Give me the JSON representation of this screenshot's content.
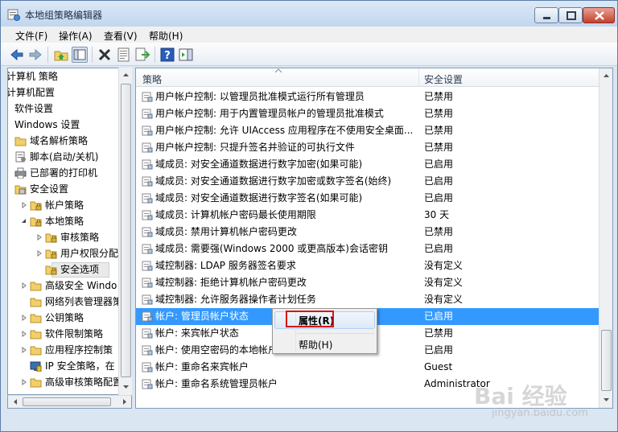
{
  "window": {
    "title": "本地组策略编辑器"
  },
  "menu": [
    {
      "label": "文件(F)"
    },
    {
      "label": "操作(A)"
    },
    {
      "label": "查看(V)"
    },
    {
      "label": "帮助(H)"
    }
  ],
  "toolbar": {
    "icons": [
      "back-icon",
      "forward-icon",
      "up-folder-icon",
      "show-hide-tree-icon",
      "delete-icon",
      "properties-icon",
      "export-list-icon",
      "help-icon",
      "show-action-pane-icon"
    ]
  },
  "tree": {
    "items": [
      {
        "label": "计算机 策略",
        "indent": 0,
        "icon": "none"
      },
      {
        "label": "计算机配置",
        "indent": 0,
        "icon": "none"
      },
      {
        "label": "软件设置",
        "indent": 1,
        "icon": "none"
      },
      {
        "label": "Windows 设置",
        "indent": 1,
        "icon": "none"
      },
      {
        "label": "域名解析策略",
        "indent": 2,
        "icon": "folder"
      },
      {
        "label": "脚本(启动/关机)",
        "indent": 2,
        "icon": "script"
      },
      {
        "label": "已部署的打印机",
        "indent": 2,
        "icon": "printer"
      },
      {
        "label": "安全设置",
        "indent": 2,
        "icon": "security"
      },
      {
        "label": "帐户策略",
        "indent": 3,
        "icon": "folder-lock",
        "twisty": "collapsed"
      },
      {
        "label": "本地策略",
        "indent": 3,
        "icon": "folder-lock",
        "twisty": "expanded"
      },
      {
        "label": "审核策略",
        "indent": 4,
        "icon": "folder-lock",
        "twisty": "collapsed"
      },
      {
        "label": "用户权限分配",
        "indent": 4,
        "icon": "folder-lock",
        "twisty": "collapsed"
      },
      {
        "label": "安全选项",
        "indent": 4,
        "icon": "folder-lock",
        "selected": true
      },
      {
        "label": "高级安全 Windo",
        "indent": 3,
        "icon": "folder",
        "twisty": "collapsed"
      },
      {
        "label": "网络列表管理器策",
        "indent": 3,
        "icon": "folder"
      },
      {
        "label": "公钥策略",
        "indent": 3,
        "icon": "folder",
        "twisty": "collapsed"
      },
      {
        "label": "软件限制策略",
        "indent": 3,
        "icon": "folder",
        "twisty": "collapsed"
      },
      {
        "label": "应用程序控制策",
        "indent": 3,
        "icon": "folder",
        "twisty": "collapsed"
      },
      {
        "label": "IP 安全策略，在",
        "indent": 3,
        "icon": "ipsec"
      },
      {
        "label": "高级审核策略配置",
        "indent": 3,
        "icon": "folder",
        "twisty": "collapsed"
      }
    ]
  },
  "list": {
    "columns": {
      "policy": "策略",
      "setting": "安全设置"
    },
    "rows": [
      {
        "policy": "用户帐户控制: 以管理员批准模式运行所有管理员",
        "setting": "已禁用"
      },
      {
        "policy": "用户帐户控制: 用于内置管理员帐户的管理员批准模式",
        "setting": "已禁用"
      },
      {
        "policy": "用户帐户控制: 允许 UIAccess 应用程序在不使用安全桌面...",
        "setting": "已禁用"
      },
      {
        "policy": "用户帐户控制: 只提升签名并验证的可执行文件",
        "setting": "已禁用"
      },
      {
        "policy": "域成员: 对安全通道数据进行数字加密(如果可能)",
        "setting": "已启用"
      },
      {
        "policy": "域成员: 对安全通道数据进行数字加密或数字签名(始终)",
        "setting": "已启用"
      },
      {
        "policy": "域成员: 对安全通道数据进行数字签名(如果可能)",
        "setting": "已启用"
      },
      {
        "policy": "域成员: 计算机帐户密码最长使用期限",
        "setting": "30 天"
      },
      {
        "policy": "域成员: 禁用计算机帐户密码更改",
        "setting": "已禁用"
      },
      {
        "policy": "域成员: 需要强(Windows 2000 或更高版本)会话密钥",
        "setting": "已启用"
      },
      {
        "policy": "域控制器: LDAP 服务器签名要求",
        "setting": "没有定义"
      },
      {
        "policy": "域控制器: 拒绝计算机帐户密码更改",
        "setting": "没有定义"
      },
      {
        "policy": "域控制器: 允许服务器操作者计划任务",
        "setting": "没有定义"
      },
      {
        "policy": "帐户: 管理员帐户状态",
        "setting": "已启用",
        "selected": true
      },
      {
        "policy": "帐户: 来宾帐户状态",
        "setting": "已禁用"
      },
      {
        "policy": "帐户: 使用空密码的本地帐户",
        "setting": "已启用"
      },
      {
        "policy": "帐户: 重命名来宾帐户",
        "setting": "Guest"
      },
      {
        "policy": "帐户: 重命名系统管理员帐户",
        "setting": "Administrator"
      }
    ]
  },
  "context_menu": {
    "items": [
      {
        "label": "属性(R)",
        "bold": true
      },
      {
        "label": "帮助(H)"
      }
    ]
  },
  "watermark": {
    "main": "Bai 经验",
    "sub": "jingyan.baidu.com"
  },
  "colors": {
    "selection": "#3399ff",
    "highlight_box": "#d8160a"
  }
}
